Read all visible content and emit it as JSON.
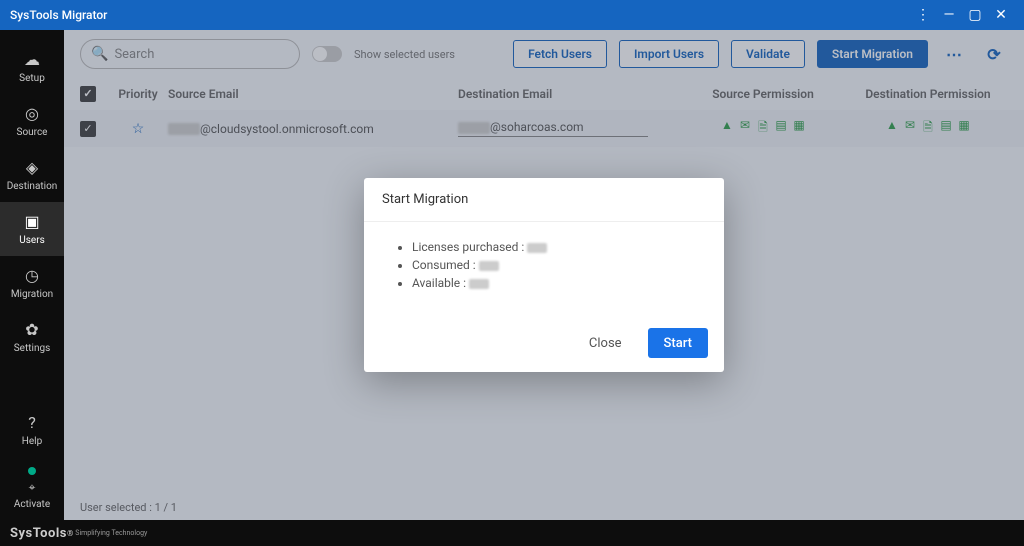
{
  "app": {
    "title": "SysTools Migrator"
  },
  "sidebar": {
    "items": [
      {
        "label": "Setup"
      },
      {
        "label": "Source"
      },
      {
        "label": "Destination"
      },
      {
        "label": "Users"
      },
      {
        "label": "Migration"
      },
      {
        "label": "Settings"
      }
    ],
    "help": "Help",
    "activate": "Activate"
  },
  "toolbar": {
    "search_placeholder": "Search",
    "show_selected": "Show selected users",
    "fetch": "Fetch Users",
    "import": "Import Users",
    "validate": "Validate",
    "start": "Start Migration"
  },
  "table": {
    "headers": {
      "priority": "Priority",
      "source_email": "Source Email",
      "destination_email": "Destination Email",
      "source_perm": "Source Permission",
      "dest_perm": "Destination Permission"
    },
    "rows": [
      {
        "source_email_suffix": "@cloudsystool.onmicrosoft.com",
        "destination_email_suffix": "@soharcoas.com"
      }
    ]
  },
  "status": {
    "user_selected": "User selected : 1 / 1"
  },
  "dialog": {
    "title": "Start Migration",
    "licenses_label": "Licenses purchased :",
    "consumed_label": "Consumed :",
    "available_label": "Available :",
    "close": "Close",
    "start": "Start"
  },
  "footer": {
    "brand": "SysTools",
    "tagline": "Simplifying Technology"
  }
}
